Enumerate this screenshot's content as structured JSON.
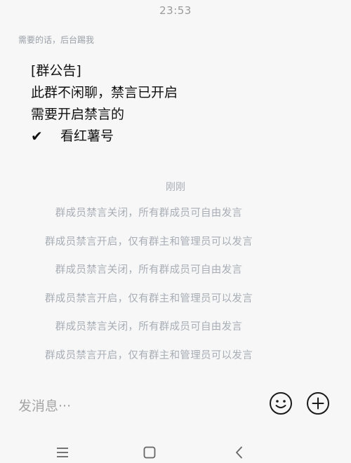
{
  "status_bar": {
    "time": "23:53"
  },
  "message": {
    "sender": "需要的话，后台踢我",
    "lines": [
      "[群公告]",
      "此群不闲聊，禁言已开启",
      "需要开启禁言的"
    ],
    "check_symbol": "✔",
    "check_text": "看红薯号"
  },
  "system": {
    "time_label": "刚刚",
    "notices": [
      "群成员禁言关闭，所有群成员可自由发言",
      "群成员禁言开启，仅有群主和管理员可以发言",
      "群成员禁言关闭，所有群成员可自由发言",
      "群成员禁言开启，仅有群主和管理员可以发言",
      "群成员禁言关闭，所有群成员可自由发言",
      "群成员禁言开启，仅有群主和管理员可以发言"
    ]
  },
  "input": {
    "placeholder": "发消息···"
  },
  "icons": {
    "emoji": "smiley-face-icon",
    "plus": "plus-circle-icon",
    "nav_menu": "menu-icon",
    "nav_home": "square-home-icon",
    "nav_back": "back-chevron-icon"
  }
}
